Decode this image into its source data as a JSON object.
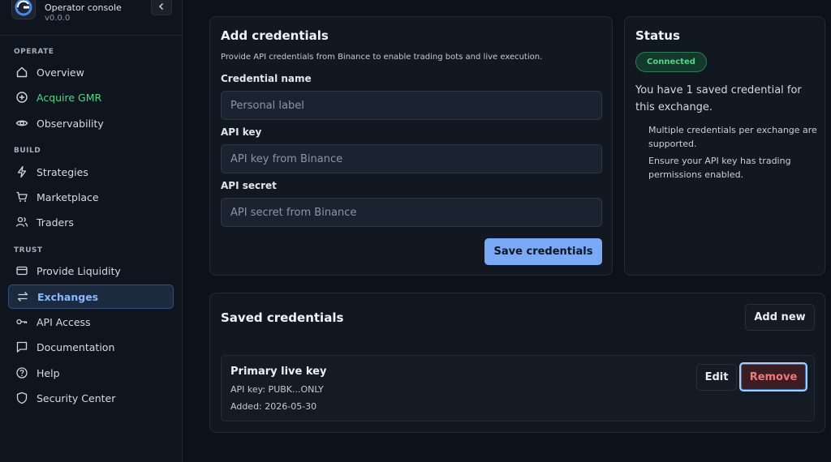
{
  "app": {
    "name": "Operator console",
    "version": "v0.0.0"
  },
  "sidebar": {
    "sections": [
      {
        "label": "OPERATE"
      },
      {
        "label": "BUILD"
      },
      {
        "label": "TRUST"
      }
    ],
    "items": [
      {
        "label": "Overview",
        "icon": "home-icon"
      },
      {
        "label": "Acquire GMR",
        "icon": "plus-circle-icon",
        "color": "#58d38a"
      },
      {
        "label": "Observability",
        "icon": "eye-icon"
      },
      {
        "label": "Strategies",
        "icon": "bolt-icon"
      },
      {
        "label": "Marketplace",
        "icon": "cart-icon"
      },
      {
        "label": "Traders",
        "icon": "users-icon"
      },
      {
        "label": "Provide Liquidity",
        "icon": "card-icon"
      },
      {
        "label": "Exchanges",
        "icon": "swap-icon",
        "active": true
      },
      {
        "label": "API Access",
        "icon": "key-icon"
      },
      {
        "label": "Documentation",
        "icon": "chat-icon"
      },
      {
        "label": "Help",
        "icon": "help-icon"
      },
      {
        "label": "Security Center",
        "icon": "shield-icon"
      }
    ]
  },
  "add_credentials": {
    "title": "Add credentials",
    "description": "Provide API credentials from Binance to enable trading bots and live execution.",
    "credential_name_label": "Credential name",
    "credential_name_placeholder": "Personal label",
    "credential_name_value": "",
    "api_key_label": "API key",
    "api_key_placeholder": "API key from Binance",
    "api_key_value": "",
    "api_secret_label": "API secret",
    "api_secret_placeholder": "API secret from Binance",
    "api_secret_value": "",
    "save_label": "Save credentials"
  },
  "status": {
    "title": "Status",
    "badge": "Connected",
    "summary": "You have 1 saved credential for this exchange.",
    "notes": [
      "Multiple credentials per exchange are supported.",
      "Ensure your API key has trading permissions enabled."
    ]
  },
  "saved_credentials": {
    "title": "Saved credentials",
    "add_new_label": "Add new",
    "items": [
      {
        "name": "Primary live key",
        "api_key_line": "API key: PUBK...ONLY",
        "added_line": "Added: 2026-05-30",
        "edit_label": "Edit",
        "remove_label": "Remove"
      }
    ]
  },
  "colors": {
    "accent": "#7aaaf6",
    "success": "#58d38a",
    "danger": "#f0787c",
    "background": "#0c121b"
  }
}
